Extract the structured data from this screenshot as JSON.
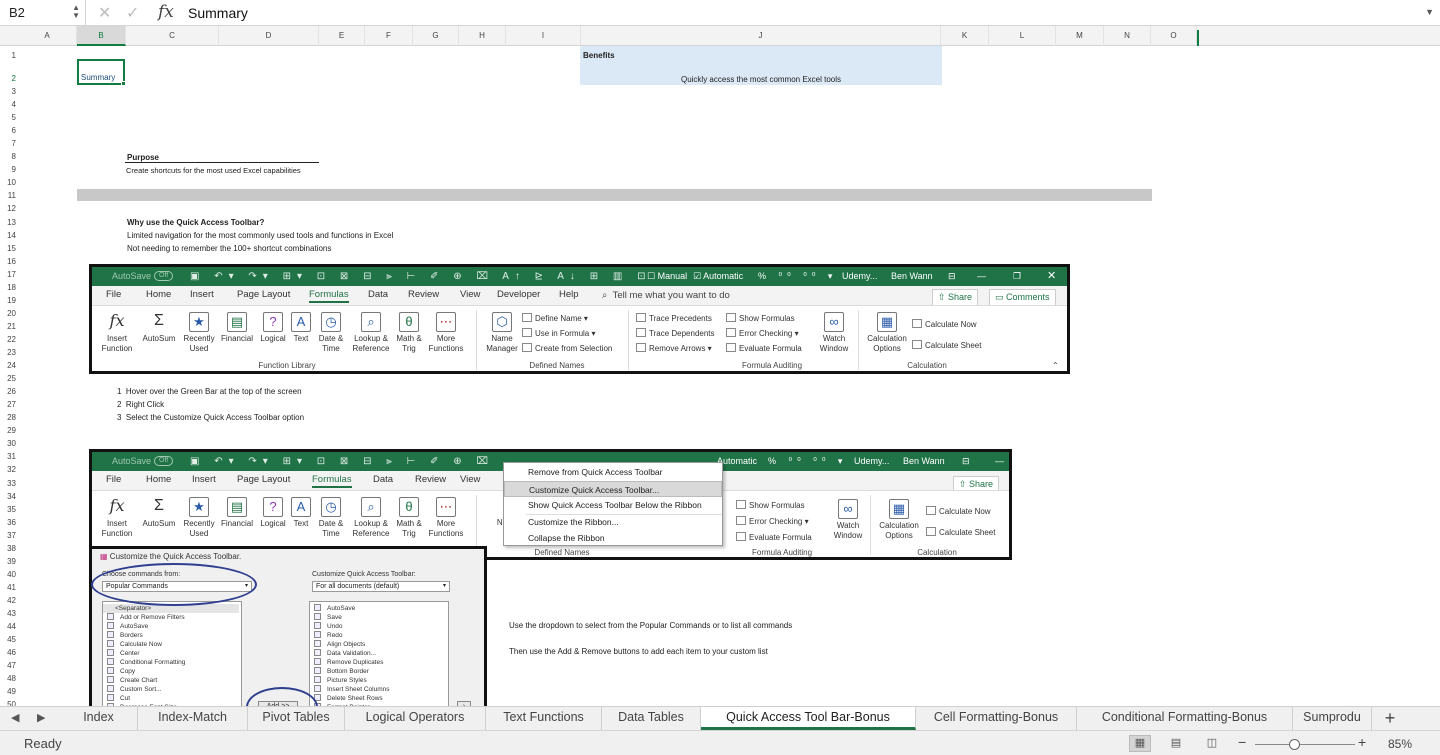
{
  "formula_bar": {
    "name_box": "B2",
    "cancel_icon": "✕",
    "enter_icon": "✓",
    "fx": "fx",
    "value": "Summary"
  },
  "columns": [
    "A",
    "B",
    "C",
    "D",
    "E",
    "F",
    "G",
    "H",
    "I",
    "J",
    "K",
    "L",
    "M",
    "N",
    "O"
  ],
  "rows": [
    "1",
    "2",
    "3",
    "4",
    "5",
    "6",
    "7",
    "8",
    "9",
    "10",
    "11",
    "12",
    "13",
    "14",
    "15",
    "16",
    "17",
    "18",
    "19",
    "20",
    "21",
    "22",
    "23",
    "24",
    "25",
    "26",
    "27",
    "28",
    "29",
    "30",
    "31",
    "32",
    "33",
    "34",
    "35",
    "36",
    "37",
    "38",
    "39",
    "40",
    "41",
    "42",
    "43",
    "44",
    "45",
    "46",
    "47",
    "48",
    "49",
    "50"
  ],
  "cells": {
    "b2": "Summary",
    "benefits_title": "Benefits",
    "benefits_text": "Quickly access the most common Excel tools",
    "purpose_title": "Purpose",
    "purpose_text": "Create shortcuts for the most used Excel capabilities",
    "why_title": "Why use the Quick Access Toolbar?",
    "why_1": "Limited navigation for the most commonly used tools and functions in Excel",
    "why_2": "Not needing to remember the 100+ shortcut combinations",
    "steps": [
      {
        "n": "1",
        "text": "Hover over the Green Bar at the top of the screen"
      },
      {
        "n": "2",
        "text": "Right Click"
      },
      {
        "n": "3",
        "text": "Select the Customize Quick Access Toolbar option"
      }
    ],
    "note_1": "Use the dropdown to select from the Popular Commands or to list all commands",
    "note_2": "Then use the Add & Remove buttons to add each item to your custom list"
  },
  "ribbon": {
    "autosave": "AutoSave",
    "toggle": "Off",
    "manual": "Manual",
    "automatic": "Automatic",
    "udemy": "Udemy...",
    "udemy_short": "Udemy...",
    "user": "Ben Wann",
    "tabs": [
      "File",
      "Home",
      "Insert",
      "Page Layout",
      "Formulas",
      "Data",
      "Review",
      "View",
      "Developer",
      "Help"
    ],
    "tell_me": "Tell me what you want to do",
    "share": "Share",
    "comments": "Comments",
    "function_buttons": [
      {
        "label": "Insert\nFunction",
        "icon": "fx"
      },
      {
        "label": "AutoSum",
        "icon": "Σ"
      },
      {
        "label": "Recently\nUsed",
        "icon": "★"
      },
      {
        "label": "Financial",
        "icon": "▤"
      },
      {
        "label": "Logical",
        "icon": "?"
      },
      {
        "label": "Text",
        "icon": "A"
      },
      {
        "label": "Date &\nTime",
        "icon": "◷"
      },
      {
        "label": "Lookup &\nReference",
        "icon": "⌕"
      },
      {
        "label": "Math &\nTrig",
        "icon": "θ"
      },
      {
        "label": "More\nFunctions",
        "icon": "⋯"
      }
    ],
    "name_manager": "Name\nManager",
    "define_name": "Define Name",
    "use_in_formula": "Use in Formula",
    "create_from_selection": "Create from Selection",
    "trace_precedents": "Trace Precedents",
    "trace_dependents": "Trace Dependents",
    "remove_arrows": "Remove Arrows",
    "show_formulas": "Show Formulas",
    "error_checking": "Error Checking",
    "evaluate_formula": "Evaluate Formula",
    "watch_window": "Watch\nWindow",
    "calc_options": "Calculation\nOptions",
    "calc_now": "Calculate Now",
    "calc_sheet": "Calculate Sheet",
    "groups": {
      "function_library": "Function Library",
      "defined_names": "Defined Names",
      "formula_auditing": "Formula Auditing",
      "calculation": "Calculation"
    }
  },
  "context_menu": [
    "Remove from Quick Access Toolbar",
    "Customize Quick Access Toolbar...",
    "Show Quick Access Toolbar Below the Ribbon",
    "Customize the Ribbon...",
    "Collapse the Ribbon"
  ],
  "dialog": {
    "title": "Customize the Quick Access Toolbar.",
    "choose_label": "Choose commands from:",
    "choose_value": "Popular Commands",
    "customize_label": "Customize Quick Access Toolbar:",
    "customize_value": "For all documents (default)",
    "left_list": [
      "<Separator>",
      "Add or Remove Filters",
      "AutoSave",
      "Borders",
      "Calculate Now",
      "Center",
      "Conditional Formatting",
      "Copy",
      "Create Chart",
      "Custom Sort...",
      "Cut",
      "Decrease Font Size"
    ],
    "right_list": [
      "AutoSave",
      "Save",
      "Undo",
      "Redo",
      "Align Objects",
      "Data Validation...",
      "Remove Duplicates",
      "Bottom Border",
      "Picture Styles",
      "Insert Sheet Columns",
      "Delete Sheet Rows",
      "Format Painter"
    ],
    "add_button": "Add >>"
  },
  "sheet_tabs": [
    "Index",
    "Index-Match",
    "Pivot Tables",
    "Logical Operators",
    "Text Functions",
    "Data Tables",
    "Quick Access Tool Bar-Bonus",
    "Cell Formatting-Bonus",
    "Conditional Formatting-Bonus",
    "Sumprodu"
  ],
  "active_sheet": "Quick Access Tool Bar-Bonus",
  "status": {
    "ready": "Ready",
    "zoom": "85%",
    "minus": "−",
    "plus": "+",
    "add_sheet": "+"
  },
  "colors": {
    "excel_green": "#1f7346",
    "selection_green": "#107c41",
    "benefit_fill": "#dbe9f6",
    "oval_blue": "#2f3f8f"
  }
}
